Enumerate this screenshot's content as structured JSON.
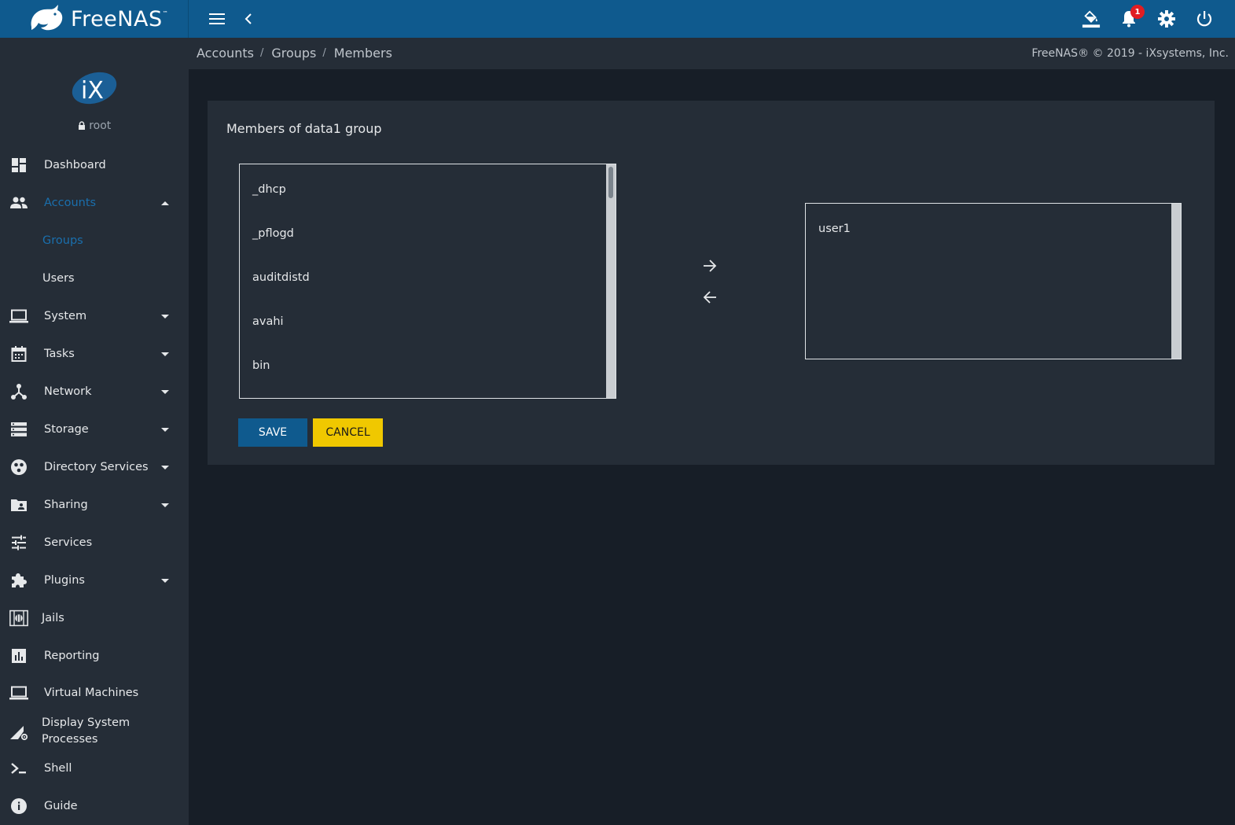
{
  "app": {
    "brand": "FreeNAS",
    "brand_tm": "™",
    "user": "root",
    "notification_count": "1",
    "colors": {
      "topbar": "#0f5a8e",
      "sidebar": "#252d37",
      "background": "#171e27",
      "accent": "#1a6fad",
      "save": "#0f5a8e",
      "cancel": "#f0c800"
    }
  },
  "sidebar": {
    "items": [
      {
        "label": "Dashboard",
        "icon": "dashboard-icon"
      },
      {
        "label": "Accounts",
        "icon": "people-icon"
      },
      {
        "label": "Groups"
      },
      {
        "label": "Users"
      },
      {
        "label": "System",
        "icon": "laptop-icon"
      },
      {
        "label": "Tasks",
        "icon": "calendar-icon"
      },
      {
        "label": "Network",
        "icon": "network-icon"
      },
      {
        "label": "Storage",
        "icon": "storage-icon"
      },
      {
        "label": "Directory Services",
        "icon": "directory-icon"
      },
      {
        "label": "Sharing",
        "icon": "folder-shared-icon"
      },
      {
        "label": "Services",
        "icon": "tune-icon"
      },
      {
        "label": "Plugins",
        "icon": "puzzle-icon"
      },
      {
        "label": "Jails",
        "icon": "jail-icon"
      },
      {
        "label": "Reporting",
        "icon": "chart-icon"
      },
      {
        "label": "Virtual Machines",
        "icon": "laptop-icon"
      },
      {
        "label": "Display System Processes",
        "icon": "settings-cell-icon"
      },
      {
        "label": "Shell",
        "icon": "terminal-icon"
      },
      {
        "label": "Guide",
        "icon": "info-icon"
      }
    ]
  },
  "breadcrumb": {
    "items": [
      "Accounts",
      "Groups",
      "Members"
    ],
    "separator": "/"
  },
  "copyright": "FreeNAS® © 2019 - iXsystems, Inc.",
  "card": {
    "title": "Members of data1 group",
    "available": [
      "_dhcp",
      "_pflogd",
      "auditdistd",
      "avahi",
      "bin"
    ],
    "selected": [
      "user1"
    ],
    "save_label": "SAVE",
    "cancel_label": "CANCEL"
  }
}
